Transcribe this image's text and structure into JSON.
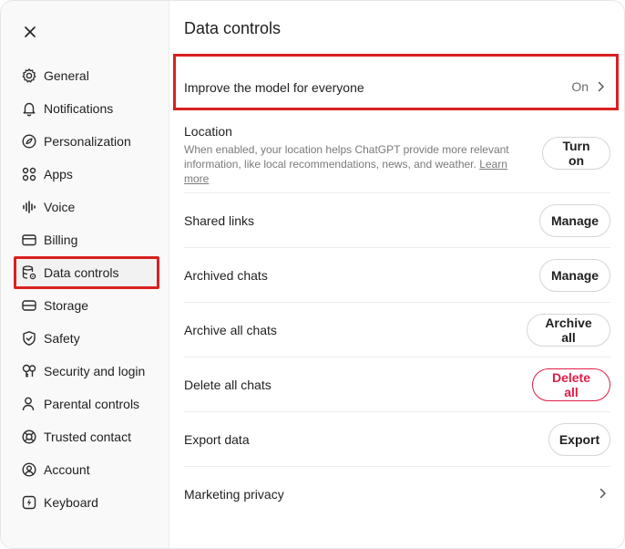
{
  "sidebar": {
    "items": [
      {
        "label": "General",
        "icon": "gear-icon"
      },
      {
        "label": "Notifications",
        "icon": "bell-icon"
      },
      {
        "label": "Personalization",
        "icon": "personalization-icon"
      },
      {
        "label": "Apps",
        "icon": "apps-grid-icon"
      },
      {
        "label": "Voice",
        "icon": "voice-waveform-icon"
      },
      {
        "label": "Billing",
        "icon": "card-icon"
      },
      {
        "label": "Data controls",
        "icon": "database-gear-icon",
        "active": true
      },
      {
        "label": "Storage",
        "icon": "storage-drive-icon"
      },
      {
        "label": "Safety",
        "icon": "shield-check-icon"
      },
      {
        "label": "Security and login",
        "icon": "key-lock-icon"
      },
      {
        "label": "Parental controls",
        "icon": "parental-user-icon"
      },
      {
        "label": "Trusted contact",
        "icon": "lifebuoy-icon"
      },
      {
        "label": "Account",
        "icon": "account-circle-icon"
      },
      {
        "label": "Keyboard",
        "icon": "keyboard-lightning-icon"
      }
    ]
  },
  "main": {
    "title": "Data controls",
    "improve": {
      "label": "Improve the model for everyone",
      "value": "On"
    },
    "location": {
      "label": "Location",
      "description": "When enabled, your location helps ChatGPT provide more relevant information, like local recommendations, news, and weather.",
      "learn_more": "Learn more",
      "button": "Turn on"
    },
    "shared_links": {
      "label": "Shared links",
      "button": "Manage"
    },
    "archived_chats": {
      "label": "Archived chats",
      "button": "Manage"
    },
    "archive_all": {
      "label": "Archive all chats",
      "button": "Archive all"
    },
    "delete_all": {
      "label": "Delete all chats",
      "button": "Delete all"
    },
    "export": {
      "label": "Export data",
      "button": "Export"
    },
    "marketing": {
      "label": "Marketing privacy"
    }
  },
  "colors": {
    "highlight": "#d92020",
    "danger": "#e11d48",
    "muted_text": "#7a7a7a"
  }
}
